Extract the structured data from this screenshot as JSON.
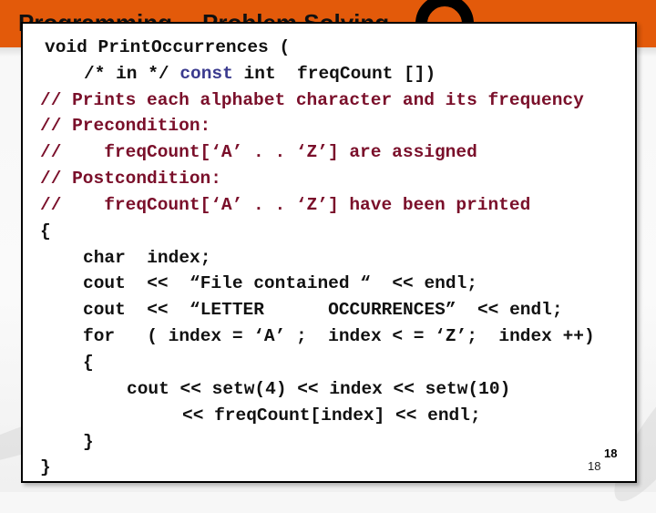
{
  "header": {
    "title_part1": "Programming",
    "title_part2": "Problem Solving",
    "logo": "C++ logo",
    "accent_color": "#e35a0a"
  },
  "code": {
    "line1": "void PrintOccurrences (",
    "line2_a": "/* in */ ",
    "line2_kw": "const",
    "line2_b": " int  freqCount [])",
    "line3": "// Prints each alphabet character and its frequency",
    "line4": "// Precondition:",
    "line5": "//    freqCount[‘A’ . . ‘Z’] are assigned",
    "line6": "// Postcondition:",
    "line7": "//    freqCount[‘A’ . . ‘Z’] have been printed",
    "line8": "{",
    "line9": "char  index;",
    "line10": "cout  <<  “File contained “  << endl;",
    "line11": "cout  <<  “LETTER      OCCURRENCES”  << endl;",
    "line12": "for   ( index = ‘A’ ;  index < = ‘Z’;  index ++)",
    "line13": "{",
    "line14": "cout << setw(4) << index << setw(10)",
    "line15": "<< freqCount[index] << endl;",
    "line16": "}",
    "line17": "}"
  },
  "footer": {
    "slide_number_small": "18",
    "slide_number_big": "18"
  }
}
